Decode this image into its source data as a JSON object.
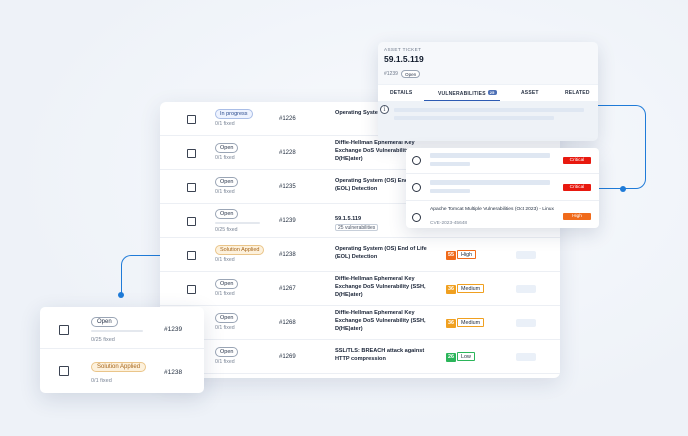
{
  "colors": {
    "accent": "#1f7bd8",
    "critical": "#e8190f",
    "high": "#f06a1a",
    "medium": "#f0a020",
    "low": "#2bb55a"
  },
  "table": {
    "rows": [
      {
        "status": "In progress",
        "status_kind": "progress",
        "fixed": "0/1 fixed",
        "id": "#1226",
        "name": "Operating System (EOL) Detection",
        "count": "",
        "score": "",
        "severity": ""
      },
      {
        "status": "Open",
        "status_kind": "open",
        "fixed": "0/1 fixed",
        "id": "#1228",
        "name": "Diffie-Hellman Ephemeral Key Exchange DoS Vulnerability (SSH, D(HE)ater)",
        "count": "",
        "score": "",
        "severity": ""
      },
      {
        "status": "Open",
        "status_kind": "open",
        "fixed": "0/1 fixed",
        "id": "#1235",
        "name": "Operating System (OS) End of Life (EOL) Detection",
        "count": "",
        "score": "",
        "severity": ""
      },
      {
        "status": "Open",
        "status_kind": "open",
        "fixed": "0/25 fixed",
        "id": "#1239",
        "name": "59.1.5.119",
        "count": "25 vulnerabilities",
        "score": "",
        "severity": ""
      },
      {
        "status": "Solution Applied",
        "status_kind": "applied",
        "fixed": "0/1 fixed",
        "id": "#1238",
        "name": "Operating System (OS) End of Life (EOL) Detection",
        "count": "",
        "score": "55",
        "severity": "High"
      },
      {
        "status": "Open",
        "status_kind": "open",
        "fixed": "0/1 fixed",
        "id": "#1267",
        "name": "Diffie-Hellman Ephemeral Key Exchange DoS Vulnerability (SSH, D(HE)ater)",
        "count": "",
        "score": "36",
        "severity": "Medium"
      },
      {
        "status": "Open",
        "status_kind": "open",
        "fixed": "0/1 fixed",
        "id": "#1268",
        "name": "Diffie-Hellman Ephemeral Key Exchange DoS Vulnerability (SSH, D(HE)ater)",
        "count": "",
        "score": "36",
        "severity": "Medium"
      },
      {
        "status": "Open",
        "status_kind": "open",
        "fixed": "0/1 fixed",
        "id": "#1269",
        "name": "SSL/TLS: BREACH attack against HTTP compression",
        "count": "",
        "score": "26",
        "severity": "Low"
      }
    ]
  },
  "ticket": {
    "label": "ASSET TICKET",
    "title": "59.1.5.119",
    "id": "#1239",
    "status": "Open",
    "tabs": [
      {
        "label": "DETAILS"
      },
      {
        "label": "VULNERABILITIES",
        "badge": "25"
      },
      {
        "label": "ASSET"
      },
      {
        "label": "RELATED"
      }
    ]
  },
  "vuln_list": [
    {
      "name": "",
      "cve": "",
      "severity": "Critical"
    },
    {
      "name": "",
      "cve": "",
      "severity": "Critical"
    },
    {
      "name": "Apache Tomcat Multiple Vulnerabilities (Oct 2023) - Linux",
      "cve": "CVE-2023-45648",
      "severity": "High"
    }
  ],
  "mini": {
    "rows": [
      {
        "status": "Open",
        "fixed": "0/25 fixed",
        "id": "#1239"
      },
      {
        "status": "Solution Applied",
        "fixed": "0/1 fixed",
        "id": "#1238"
      }
    ]
  }
}
